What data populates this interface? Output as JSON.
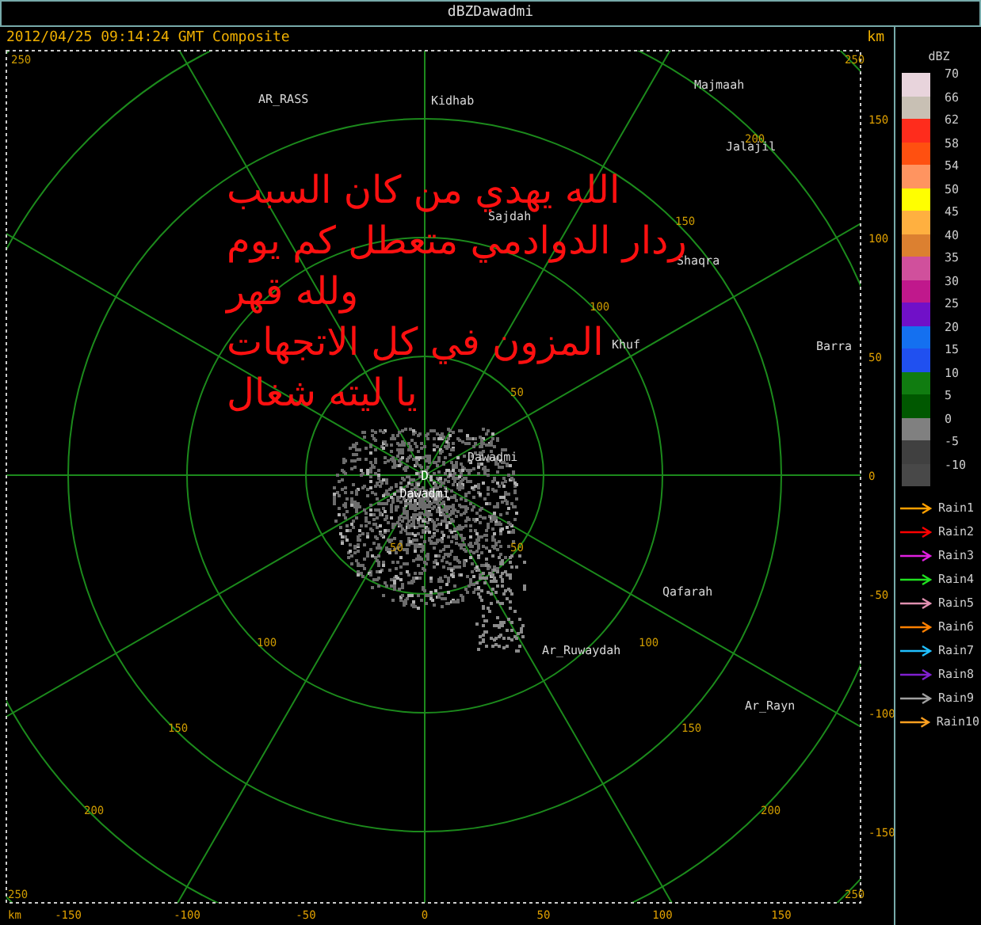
{
  "title": "dBZDawadmi",
  "header": {
    "timestamp": "2012/04/25 09:14:24 GMT Composite",
    "unit": "km"
  },
  "plot": {
    "range_labels": [
      "50",
      "50",
      "50",
      "100",
      "100",
      "100",
      "150",
      "150",
      "150",
      "200",
      "200",
      "200",
      "250",
      "250",
      "250",
      "250"
    ],
    "y_ticks": [
      "150",
      "100",
      "50",
      "0",
      "-50",
      "-100",
      "-150"
    ],
    "x_ticks": [
      "-150",
      "-100",
      "-50",
      "0",
      "50",
      "100",
      "150"
    ],
    "x_unit": "km",
    "places": [
      {
        "name": "AR_RASS"
      },
      {
        "name": "Kidhab"
      },
      {
        "name": "Majmaah"
      },
      {
        "name": "Jalajil"
      },
      {
        "name": "Sajdah"
      },
      {
        "name": "Shaqra"
      },
      {
        "name": "Barra"
      },
      {
        "name": "Khuf"
      },
      {
        "name": "Dawadmi"
      },
      {
        "name": "Qafarah"
      },
      {
        "name": "Ar_Ruwaydah"
      },
      {
        "name": "Ar_Rayn"
      }
    ],
    "site": {
      "marker": "D",
      "name": "Dawadmi"
    },
    "overlay_text": [
      "الله يهدي من كان السبب",
      "ردار الدوادمي متعطل كم يوم",
      "ولله قهر",
      "المزون في كل الاتجهات",
      "يا ليته شغال"
    ]
  },
  "legend": {
    "title": "dBZ",
    "scale": [
      {
        "label": "70",
        "color": "#e8d4dc"
      },
      {
        "label": "66",
        "color": "#c8c0b4"
      },
      {
        "label": "62",
        "color": "#ff2c1c"
      },
      {
        "label": "58",
        "color": "#ff5010"
      },
      {
        "label": "54",
        "color": "#ff9460"
      },
      {
        "label": "50",
        "color": "#ffff00"
      },
      {
        "label": "45",
        "color": "#ffb040"
      },
      {
        "label": "40",
        "color": "#dc8030"
      },
      {
        "label": "35",
        "color": "#d0509c"
      },
      {
        "label": "30",
        "color": "#c0188c"
      },
      {
        "label": "25",
        "color": "#7010c8"
      },
      {
        "label": "20",
        "color": "#1470f0"
      },
      {
        "label": "15",
        "color": "#2050f0"
      },
      {
        "label": "10",
        "color": "#107c10"
      },
      {
        "label": "5",
        "color": "#005800"
      },
      {
        "label": "0",
        "color": "#808080"
      },
      {
        "label": "-5",
        "color": "#404040"
      },
      {
        "label": "-10",
        "color": "#484848"
      }
    ],
    "tracks": [
      {
        "name": "Rain1",
        "color": "#ffa000"
      },
      {
        "name": "Rain2",
        "color": "#ff0000"
      },
      {
        "name": "Rain3",
        "color": "#e020e0"
      },
      {
        "name": "Rain4",
        "color": "#20e020"
      },
      {
        "name": "Rain5",
        "color": "#e090b0"
      },
      {
        "name": "Rain6",
        "color": "#ff8000"
      },
      {
        "name": "Rain7",
        "color": "#20c0ff"
      },
      {
        "name": "Rain8",
        "color": "#8020d0"
      },
      {
        "name": "Rain9",
        "color": "#a0a0a0"
      },
      {
        "name": "Rain10",
        "color": "#ffa020"
      }
    ]
  }
}
